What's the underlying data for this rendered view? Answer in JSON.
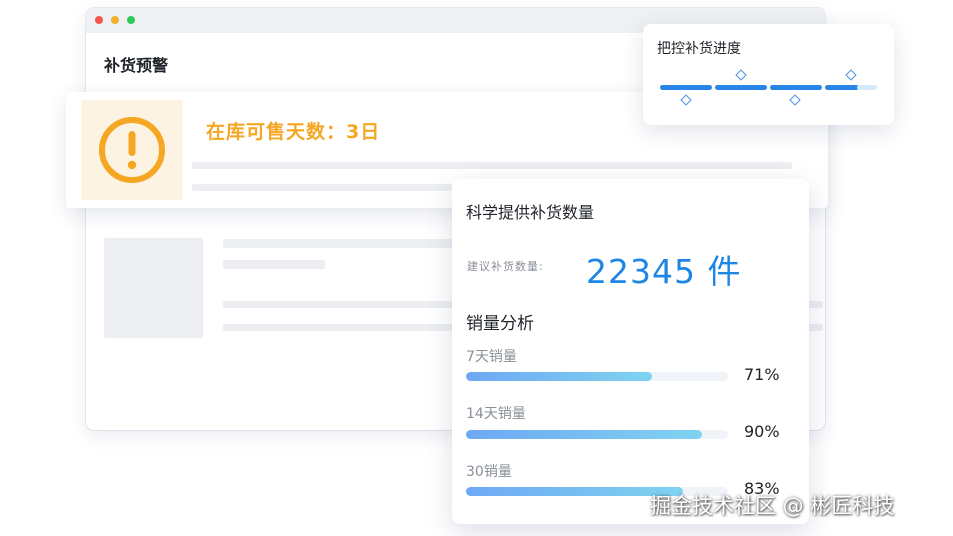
{
  "window": {
    "title": "补货预警"
  },
  "alert": {
    "icon": "exclamation-circle-icon",
    "text": "在库可售天数：3日",
    "color": "#f5a623"
  },
  "progress_card": {
    "title": "把控补货进度",
    "accent": "#2784e8"
  },
  "quantity_card": {
    "title": "科学提供补货数量",
    "suggest_label": "建议补货数量:",
    "suggest_value": "22345 件",
    "analysis_title": "销量分析",
    "bars": [
      {
        "label": "7天销量",
        "percent_text": "71%",
        "fill": 0.71
      },
      {
        "label": "14天销量",
        "percent_text": "90%",
        "fill": 0.9
      },
      {
        "label": "30销量",
        "percent_text": "83%",
        "fill": 0.83
      }
    ],
    "accent": "#1e86e6"
  },
  "watermark": "掘金技术社区 @ 彬匠科技"
}
